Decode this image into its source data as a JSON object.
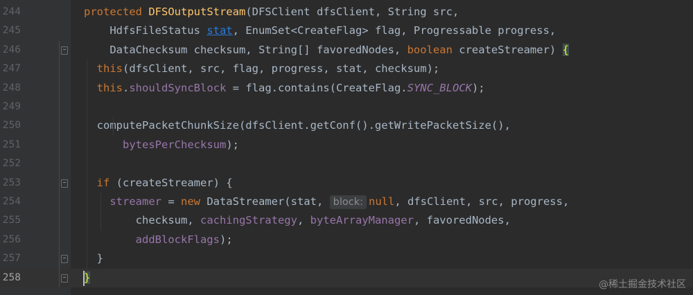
{
  "lines": [
    {
      "n": "244",
      "tokens": [
        [
          "kw",
          "protected "
        ],
        [
          "fn",
          "DFSOutputStream"
        ],
        [
          "plain",
          "(DFSClient dfsClient, String src,"
        ]
      ]
    },
    {
      "n": "245",
      "tokens": [
        [
          "plain",
          "    HdfsFileStatus "
        ],
        [
          "link",
          "stat"
        ],
        [
          "plain",
          ", EnumSet<CreateFlag> flag, Progressable progress,"
        ]
      ]
    },
    {
      "n": "246",
      "tokens": [
        [
          "plain",
          "    DataChecksum checksum, String[] favoredNodes, "
        ],
        [
          "kw",
          "boolean "
        ],
        [
          "plain",
          "createStreamer) "
        ],
        [
          "bracematch",
          "{"
        ]
      ]
    },
    {
      "n": "247",
      "tokens": [
        [
          "plain",
          "  "
        ],
        [
          "kw",
          "this"
        ],
        [
          "plain",
          "(dfsClient, src, flag, progress, stat, checksum);"
        ]
      ]
    },
    {
      "n": "248",
      "tokens": [
        [
          "plain",
          "  "
        ],
        [
          "kw",
          "this"
        ],
        [
          "plain",
          "."
        ],
        [
          "field",
          "shouldSyncBlock"
        ],
        [
          "plain",
          " = flag.contains(CreateFlag."
        ],
        [
          "fielditalic",
          "SYNC_BLOCK"
        ],
        [
          "plain",
          ");"
        ]
      ]
    },
    {
      "n": "249",
      "tokens": []
    },
    {
      "n": "250",
      "tokens": [
        [
          "plain",
          "  computePacketChunkSize(dfsClient.getConf().getWritePacketSize(),"
        ]
      ]
    },
    {
      "n": "251",
      "tokens": [
        [
          "plain",
          "      "
        ],
        [
          "field",
          "bytesPerChecksum"
        ],
        [
          "plain",
          ");"
        ]
      ]
    },
    {
      "n": "252",
      "tokens": []
    },
    {
      "n": "253",
      "tokens": [
        [
          "plain",
          "  "
        ],
        [
          "kw",
          "if "
        ],
        [
          "plain",
          "(createStreamer) {"
        ]
      ]
    },
    {
      "n": "254",
      "tokens": [
        [
          "plain",
          "    "
        ],
        [
          "field",
          "streamer"
        ],
        [
          "plain",
          " = "
        ],
        [
          "kw",
          "new "
        ],
        [
          "plain",
          "DataStreamer(stat, "
        ],
        [
          "hint",
          "block:"
        ],
        [
          "kw",
          "null"
        ],
        [
          "plain",
          ", dfsClient, src, progress,"
        ]
      ]
    },
    {
      "n": "255",
      "tokens": [
        [
          "plain",
          "        checksum, "
        ],
        [
          "field",
          "cachingStrategy"
        ],
        [
          "plain",
          ", "
        ],
        [
          "field",
          "byteArrayManager"
        ],
        [
          "plain",
          ", favoredNodes,"
        ]
      ]
    },
    {
      "n": "256",
      "tokens": [
        [
          "plain",
          "        "
        ],
        [
          "field",
          "addBlockFlags"
        ],
        [
          "plain",
          ");"
        ]
      ]
    },
    {
      "n": "257",
      "tokens": [
        [
          "plain",
          "  }"
        ]
      ]
    },
    {
      "n": "258",
      "tokens": [
        [
          "bracematch",
          "}"
        ]
      ]
    }
  ],
  "current_line": "258",
  "watermark": "@稀土掘金技术社区"
}
